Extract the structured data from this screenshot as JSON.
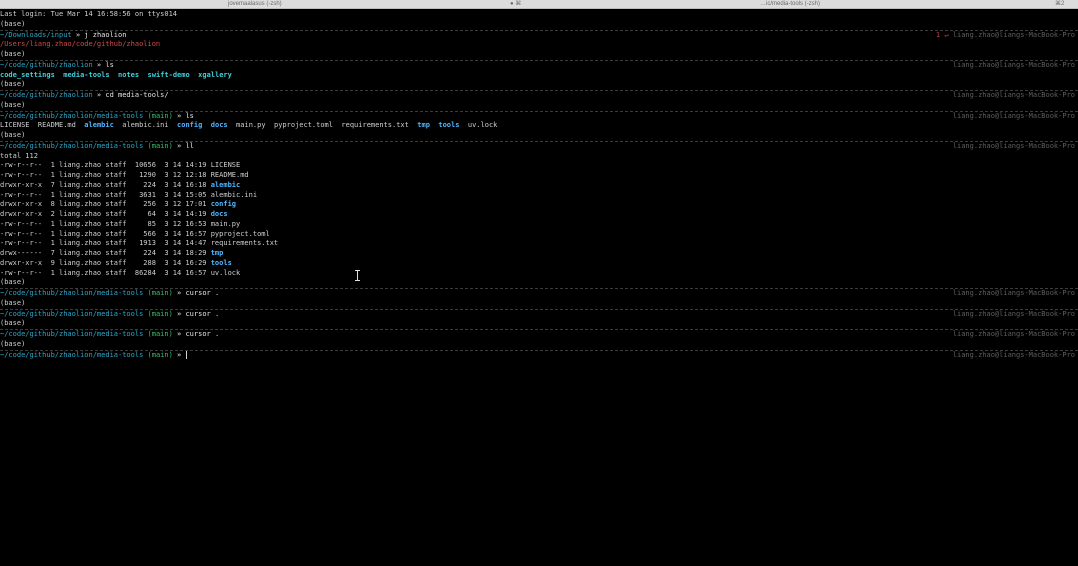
{
  "tabbar": {
    "left_tab": "jovemaalasus (-zsh)",
    "middle_tab": "…ic/media-tools (-zsh)",
    "right_tab": "⌘2"
  },
  "terminal": {
    "last_login": "Last login: Tue Mar 14 16:58:56 on ttys014",
    "host": "liang.zhao@liangs-MacBook-Pro",
    "error_marker": "1 ↵",
    "lines": {
      "base": "(base)",
      "prompt_downloads": "~/Downloads/input",
      "cmd_j": " » j zhaolion",
      "jump_target": "/Users/liang.zhao/code/github/zhaolion",
      "prompt_zhaolion": "~/code/github/zhaolion",
      "cmd_ls": " » ls",
      "ls1": [
        "code_settings",
        "media-tools",
        "notes",
        "swift-demo",
        "xgallery"
      ],
      "cmd_cd": " » cd media-tools/",
      "prompt_media": "~/code/github/zhaolion/media-tools",
      "branch": " (main)",
      "ls2": {
        "plain1": "LICENSE  README.md  ",
        "alembic": "alembic",
        "plain2": "  alembic.ini  ",
        "config": "config",
        "docs": "docs",
        "plain3": "  main.py  pyproject.toml  requirements.txt  ",
        "tmp": "tmp",
        "tools": "tools",
        "plain4": "  uv.lock"
      },
      "cmd_ll": " » ll",
      "total": "total 112",
      "ll_rows": [
        {
          "meta": "-rw-r--r--  1 liang.zhao staff  10656  3 14 14:19 ",
          "name": "LICENSE",
          "dir": false
        },
        {
          "meta": "-rw-r--r--  1 liang.zhao staff   1290  3 12 12:18 ",
          "name": "README.md",
          "dir": false
        },
        {
          "meta": "drwxr-xr-x  7 liang.zhao staff    224  3 14 16:18 ",
          "name": "alembic",
          "dir": true
        },
        {
          "meta": "-rw-r--r--  1 liang.zhao staff   3631  3 14 15:05 ",
          "name": "alembic.ini",
          "dir": false
        },
        {
          "meta": "drwxr-xr-x  8 liang.zhao staff    256  3 12 17:01 ",
          "name": "config",
          "dir": true
        },
        {
          "meta": "drwxr-xr-x  2 liang.zhao staff     64  3 14 14:19 ",
          "name": "docs",
          "dir": true
        },
        {
          "meta": "-rw-r--r--  1 liang.zhao staff     85  3 12 16:53 ",
          "name": "main.py",
          "dir": false
        },
        {
          "meta": "-rw-r--r--  1 liang.zhao staff    566  3 14 16:57 ",
          "name": "pyproject.toml",
          "dir": false
        },
        {
          "meta": "-rw-r--r--  1 liang.zhao staff   1913  3 14 14:47 ",
          "name": "requirements.txt",
          "dir": false
        },
        {
          "meta": "drwx------  7 liang.zhao staff    224  3 14 18:29 ",
          "name": "tmp",
          "dir": true
        },
        {
          "meta": "drwxr-xr-x  9 liang.zhao staff    288  3 14 16:29 ",
          "name": "tools",
          "dir": true
        },
        {
          "meta": "-rw-r--r--  1 liang.zhao staff  86284  3 14 16:57 ",
          "name": "uv.lock",
          "dir": false
        }
      ],
      "cmd_cursor": " » cursor .",
      "cmd_empty": " » "
    }
  },
  "colors": {
    "background": "#000000",
    "path": "#2aa7c9",
    "branch": "#3bbf6b",
    "directory": "#4fb6ff",
    "error": "#d14a4a"
  },
  "icons": {
    "mouse_cursor": "ibeam-cursor-icon"
  }
}
